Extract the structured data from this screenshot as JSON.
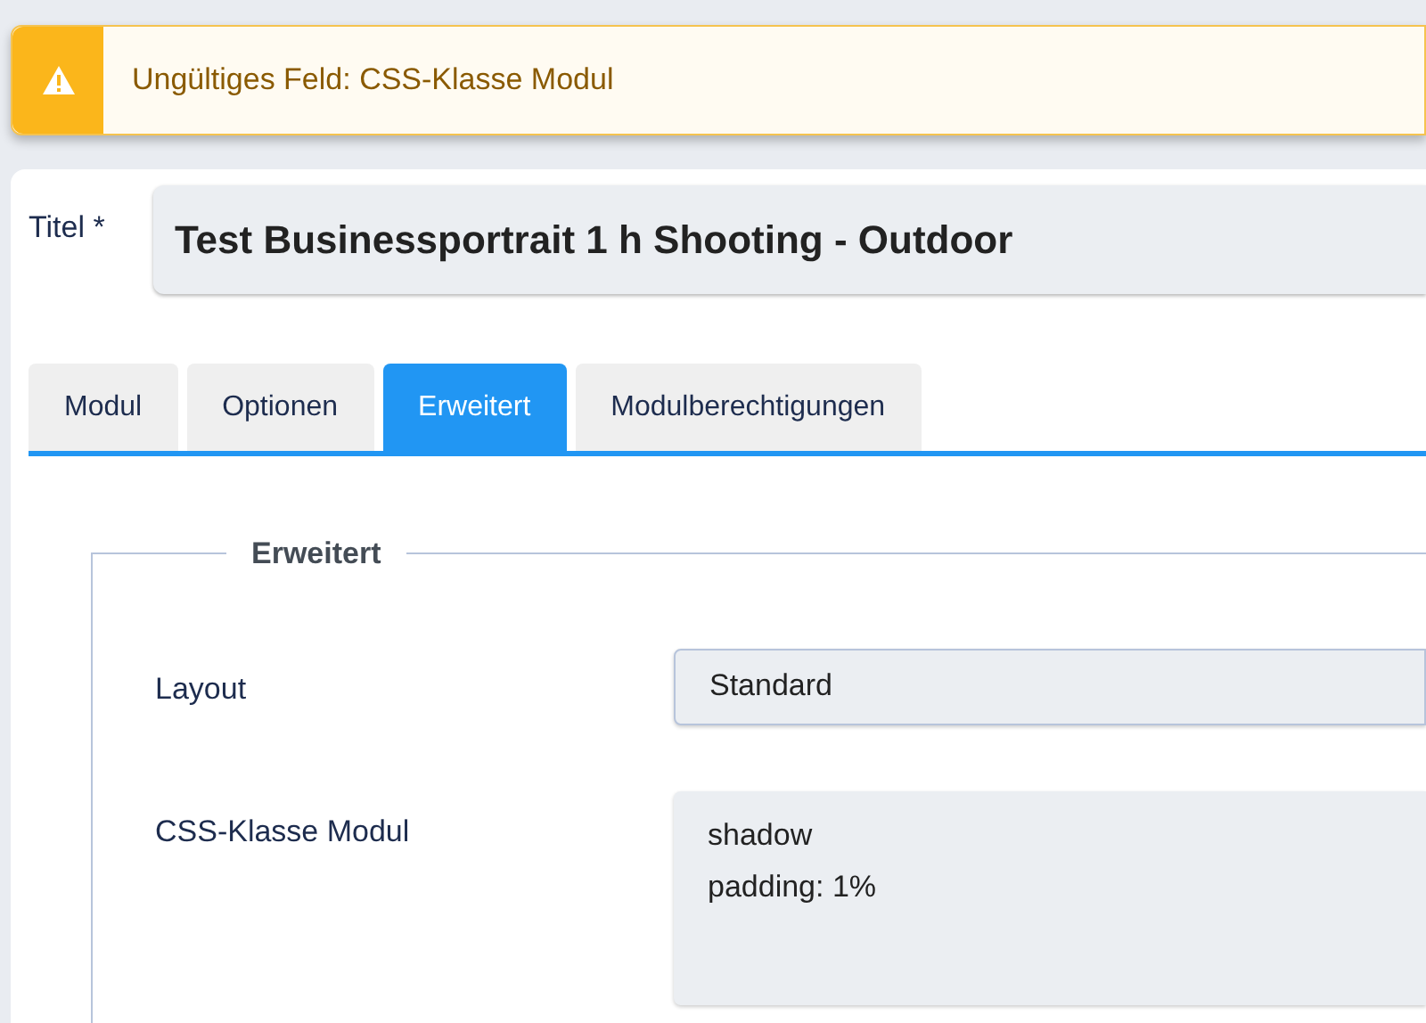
{
  "alert": {
    "message": "Ungültiges Feld: CSS-Klasse Modul"
  },
  "title_field": {
    "label": "Titel *",
    "value": "Test Businessportrait 1 h Shooting - Outdoor"
  },
  "tabs": [
    {
      "label": "Modul",
      "selected": false
    },
    {
      "label": "Optionen",
      "selected": false
    },
    {
      "label": "Erweitert",
      "selected": true
    },
    {
      "label": "Modulberechtigungen",
      "selected": false
    }
  ],
  "fieldset": {
    "legend": "Erweitert",
    "fields": [
      {
        "kind": "select",
        "label": "Layout",
        "value": "Standard"
      },
      {
        "kind": "textarea",
        "label": "CSS-Klasse Modul",
        "value": "shadow\npadding: 1%"
      }
    ]
  }
}
